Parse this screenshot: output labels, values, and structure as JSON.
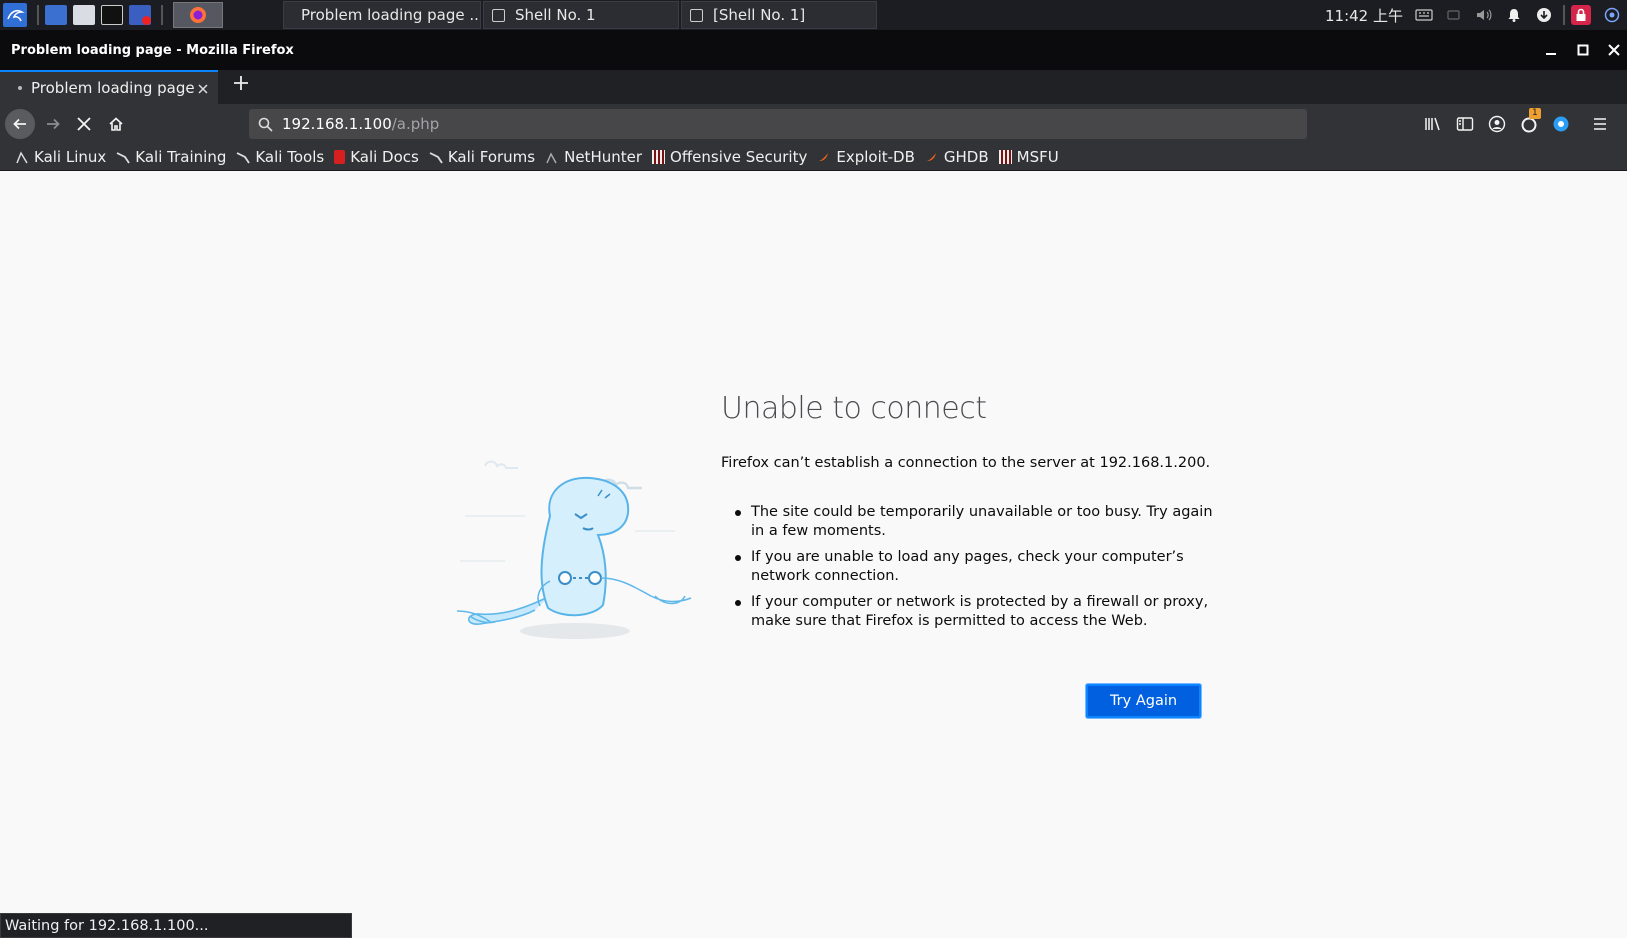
{
  "taskbar": {
    "windows": [
      {
        "label": "Problem loading page ..."
      },
      {
        "label": "Shell No. 1"
      },
      {
        "label": "[Shell No. 1]"
      }
    ],
    "clock": "11:42 上午",
    "notification_count": "1"
  },
  "window": {
    "title": "Problem loading page - Mozilla Firefox"
  },
  "tabs": [
    {
      "label": "Problem loading page",
      "active": true
    }
  ],
  "urlbar": {
    "host": "192.168.1.100",
    "path": "/a.php"
  },
  "bookmarks": [
    {
      "label": "Kali Linux",
      "icon": "kali-dragon-icon"
    },
    {
      "label": "Kali Training",
      "icon": "kali-dragon-icon"
    },
    {
      "label": "Kali Tools",
      "icon": "kali-dragon-icon"
    },
    {
      "label": "Kali Docs",
      "icon": "kali-docs-icon"
    },
    {
      "label": "Kali Forums",
      "icon": "kali-dragon-icon"
    },
    {
      "label": "NetHunter",
      "icon": "nethunter-icon"
    },
    {
      "label": "Offensive Security",
      "icon": "offsec-icon"
    },
    {
      "label": "Exploit-DB",
      "icon": "exploit-db-icon"
    },
    {
      "label": "GHDB",
      "icon": "ghdb-icon"
    },
    {
      "label": "MSFU",
      "icon": "msfu-icon"
    }
  ],
  "error": {
    "title": "Unable to connect",
    "message": "Firefox can’t establish a connection to the server at 192.168.1.200.",
    "reasons": [
      "The site could be temporarily unavailable or too busy. Try again in a few moments.",
      "If you are unable to load any pages, check your computer’s network connection.",
      "If your computer or network is protected by a firewall or proxy, make sure that Firefox is permitted to access the Web."
    ],
    "try_again_label": "Try Again"
  },
  "status": {
    "text": "Waiting for 192.168.1.100..."
  },
  "colors": {
    "accent": "#0a84ff",
    "button_blue": "#0060df",
    "toolbar": "#323336",
    "titlebar": "#0b0b0d"
  }
}
